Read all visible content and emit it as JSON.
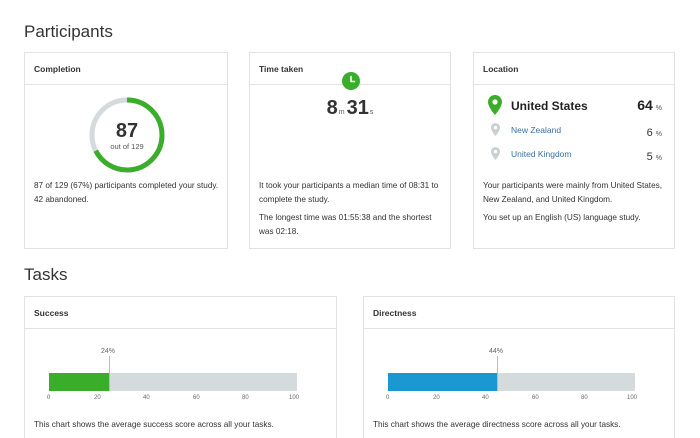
{
  "participants": {
    "title": "Participants",
    "completion": {
      "header": "Completion",
      "count": "87",
      "subtext": "out of 129",
      "completed": 87,
      "total": 129,
      "ring_color": "#3aae2a",
      "ring_track_color": "#d5dbdd",
      "description": "87 of 129 (67%) participants completed your study. 42 abandoned."
    },
    "time_taken": {
      "header": "Time taken",
      "minutes": "8",
      "minutes_unit": "m",
      "seconds": "31",
      "seconds_unit": "s",
      "clock_icon": "clock-icon",
      "description_1": "It took your participants a median time of 08:31 to complete the study.",
      "description_2": "The longest time was 01:55:38 and the shortest was 02:18."
    },
    "location": {
      "header": "Location",
      "countries": [
        {
          "name": "United States",
          "value": "64",
          "unit": "%"
        },
        {
          "name": "New Zealand",
          "value": "6",
          "unit": "%"
        },
        {
          "name": "United Kingdom",
          "value": "5",
          "unit": "%"
        }
      ],
      "pin_icon": "map-pin-icon",
      "description_1": "Your participants were mainly from United States, New Zealand, and United Kingdom.",
      "description_2": "You set up an English (US) language study."
    }
  },
  "tasks": {
    "title": "Tasks",
    "success": {
      "header": "Success",
      "marker_label": "24%",
      "value_percent": 24,
      "color": "#3aae2a",
      "description": "This chart shows the average success score across all your tasks."
    },
    "directness": {
      "header": "Directness",
      "marker_label": "44%",
      "value_percent": 44,
      "color": "#1b98d1",
      "description": "This chart shows the average directness score across all your tasks."
    },
    "axis_ticks": [
      "0",
      "20",
      "40",
      "60",
      "80",
      "100"
    ]
  }
}
